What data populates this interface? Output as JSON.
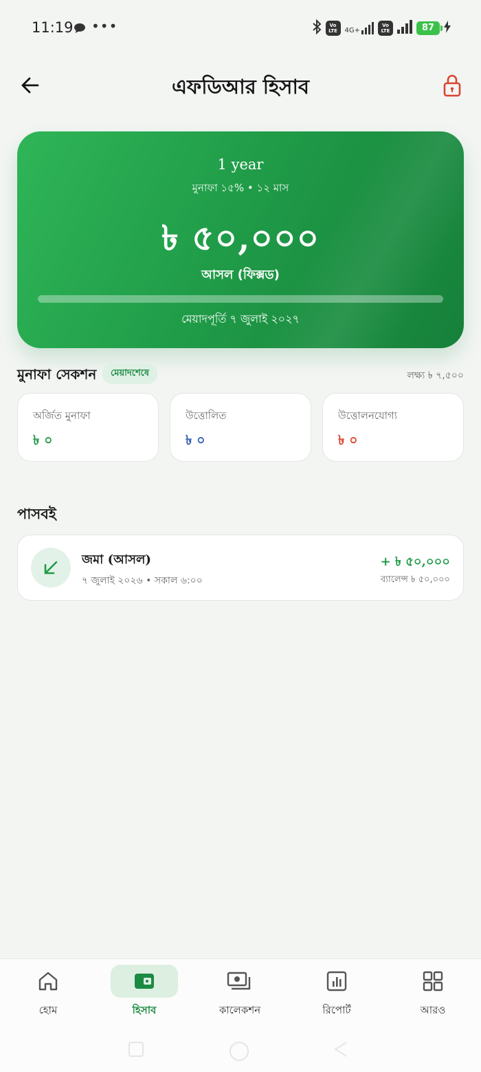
{
  "status_bar": {
    "time": "11:19",
    "dots": "•••",
    "net_label": "4G+",
    "volte": "Vo\nLTE",
    "battery": "87"
  },
  "header": {
    "title": "এফডিআর হিসাব"
  },
  "hero": {
    "plan_name": "1 year",
    "subtitle": "মুনাফা ১৫% • ১২ মাস",
    "amount": "৳ ৫০,০০০",
    "amount_caption": "আসল (ফিক্সড)",
    "progress_fraction": 0.0,
    "maturity": "মেয়াদপূর্তি ৭ জুলাই ২০২৭"
  },
  "profit": {
    "title": "মুনাফা সেকশন",
    "badge": "মেয়াদশেষে",
    "target": "লক্ষ্য ৳ ৭,৫০০",
    "cards": [
      {
        "label": "অর্জিত মুনাফা",
        "value": "৳ ০",
        "color": "#1f9a47"
      },
      {
        "label": "উত্তোলিত",
        "value": "৳ ০",
        "color": "#2f5fb0"
      },
      {
        "label": "উত্তোলনযোগ্য",
        "value": "৳ ০",
        "color": "#d9442f"
      }
    ]
  },
  "passbook": {
    "title": "পাসবই",
    "transactions": [
      {
        "title": "জমা (আসল)",
        "meta": "৭ জুলাই ২০২৬ • সকাল ৬:০০",
        "amount": "+ ৳ ৫০,০০০",
        "balance": "ব্যালেন্স ৳ ৫০,০০০",
        "icon": "arrow-down-left-icon"
      }
    ]
  },
  "bottom_nav": {
    "items": [
      {
        "label": "হোম",
        "icon": "home-icon",
        "active": false
      },
      {
        "label": "হিসাব",
        "icon": "wallet-icon",
        "active": true
      },
      {
        "label": "কালেকশন",
        "icon": "cash-icon",
        "active": false
      },
      {
        "label": "রিপোর্ট",
        "icon": "report-chart-icon",
        "active": false
      },
      {
        "label": "আরও",
        "icon": "grid-icon",
        "active": false
      }
    ]
  },
  "colors": {
    "accent": "#1f9a47",
    "lock": "#d9442f"
  }
}
